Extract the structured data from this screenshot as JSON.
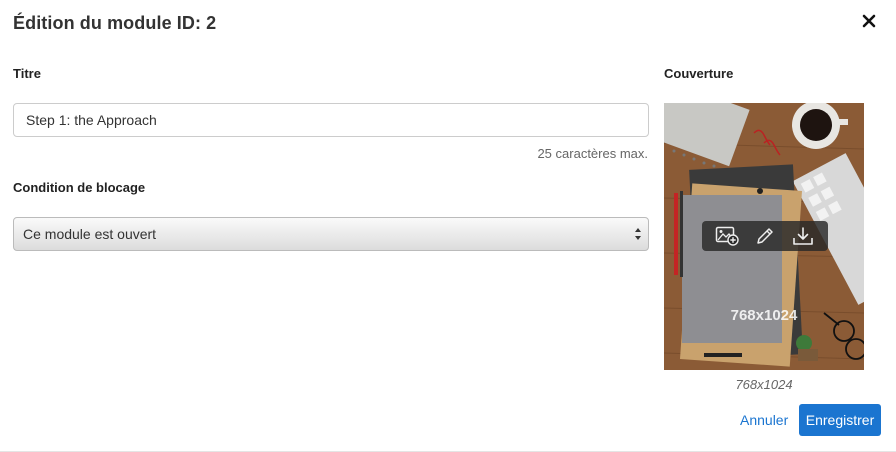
{
  "modal": {
    "title": "Édition du module ID: 2",
    "close_icon": "close-icon"
  },
  "form": {
    "title_label": "Titre",
    "title_value": "Step 1: the Approach",
    "title_helper": "25 caractères max.",
    "condition_label": "Condition de blocage",
    "condition_selected": "Ce module est ouvert"
  },
  "cover": {
    "label": "Couverture",
    "overlay_dimensions": "768x1024",
    "caption": "768x1024",
    "toolbar_icons": [
      "add-image-icon",
      "pencil-icon",
      "download-icon"
    ]
  },
  "footer": {
    "cancel_label": "Annuler",
    "save_label": "Enregistrer"
  },
  "colors": {
    "accent": "#1b75d0"
  }
}
